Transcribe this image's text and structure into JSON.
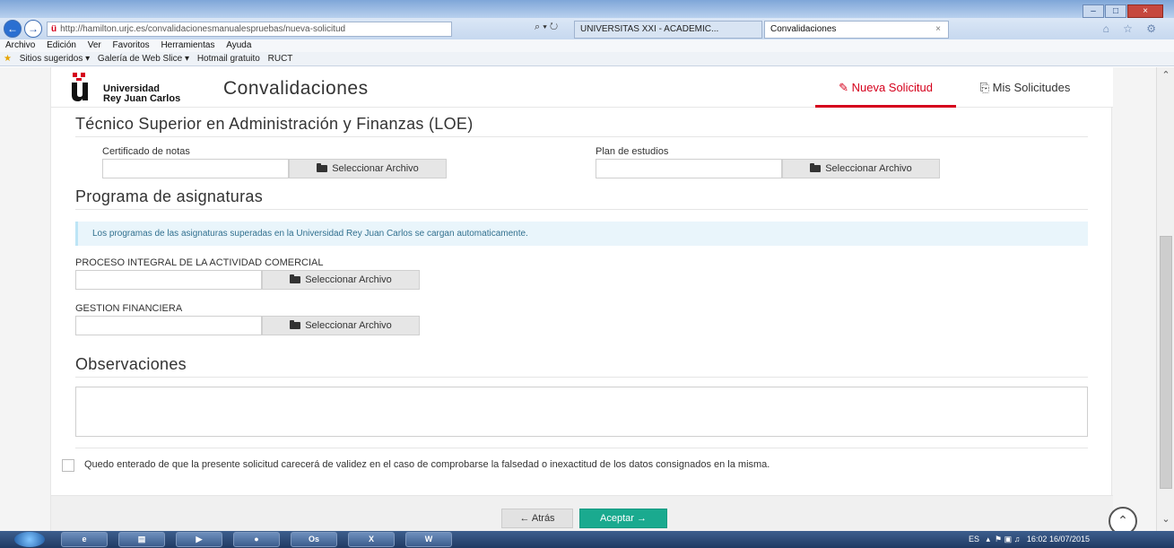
{
  "browser": {
    "url": "http://hamilton.urjc.es/convalidacionesmanualespruebas/nueva-solicitud",
    "url_icons": "⌕ ▾ ↻",
    "tabs": [
      {
        "label": "UNIVERSITAS XXI - ACADEMIC..."
      },
      {
        "label": "Convalidaciones",
        "close": "×"
      }
    ],
    "window_buttons": [
      "–",
      "□",
      "×"
    ],
    "menu": [
      "Archivo",
      "Edición",
      "Ver",
      "Favoritos",
      "Herramientas",
      "Ayuda"
    ],
    "favorites": [
      "Sitios sugeridos ▾",
      "Galería de Web Slice ▾",
      "Hotmail gratuito",
      "RUCT"
    ],
    "tool_icons": "⌂ ☆ ⚙"
  },
  "site": {
    "logo_line1": "Universidad",
    "logo_line2": "Rey Juan Carlos",
    "title": "Convalidaciones",
    "nav": [
      {
        "label": "Nueva Solicitud",
        "icon": "pencil-icon",
        "active": true
      },
      {
        "label": "Mis Solicitudes",
        "icon": "copy-icon",
        "active": false
      }
    ],
    "brand_color": "#d5001c"
  },
  "form": {
    "degree_heading": "Técnico Superior en Administración y Finanzas (LOE)",
    "certificado_label": "Certificado de notas",
    "plan_label": "Plan de estudios",
    "select_file_label": "Seleccionar Archivo",
    "programa_heading": "Programa de asignaturas",
    "info_message": "Los programas de las asignaturas superadas en la Universidad Rey Juan Carlos se cargan automaticamente.",
    "subjects": [
      {
        "name": "PROCESO INTEGRAL DE LA ACTIVIDAD COMERCIAL"
      },
      {
        "name": "GESTION FINANCIERA"
      }
    ],
    "observaciones_heading": "Observaciones",
    "observaciones_value": "",
    "consent_text": "Quedo enterado de que la presente solicitud carecerá de validez en el caso de comprobarse la falsedad o inexactitud de los datos consignados en la misma.",
    "consent_checked": false,
    "back_label": "← Atrás",
    "accept_label": "Aceptar →",
    "accept_color": "#1aaa8f"
  },
  "taskbar": {
    "apps": [
      "e",
      "▤",
      "▶",
      "●",
      "Os",
      "X",
      "W"
    ],
    "lang": "ES",
    "time": "16:02",
    "date": "16/07/2015"
  }
}
